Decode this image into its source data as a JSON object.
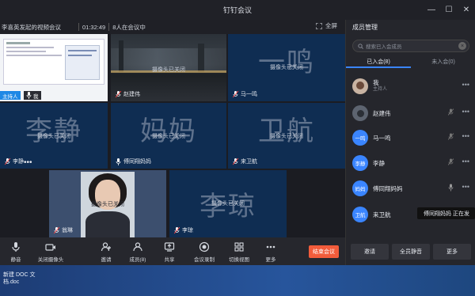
{
  "window": {
    "title": "钉钉会议"
  },
  "infobar": {
    "meeting_title": "李喜英发起的视频会议",
    "duration": "01:32:49",
    "attendance": "8人在会议中",
    "fullscreen_label": "全屏"
  },
  "tiles": [
    {
      "name": "我",
      "badge": "主持人",
      "type": "screen"
    },
    {
      "name": "赵建伟",
      "cam": "摄像头已关闭",
      "type": "scene"
    },
    {
      "name": "马一鸣",
      "big": "一鸣",
      "cam": "摄像头已关闭",
      "type": "avatar"
    },
    {
      "name": "李静",
      "big": "李静",
      "cam": "摄像头已关闭",
      "type": "avatar"
    },
    {
      "name": "傅同翔妈妈",
      "big": "妈妈",
      "cam": "摄像头已关闭",
      "type": "avatar"
    },
    {
      "name": "来卫航",
      "big": "卫航",
      "cam": "摄像头已关闭",
      "type": "avatar"
    },
    {
      "name": "翁琳",
      "cam": "摄像头已关闭",
      "type": "photo"
    },
    {
      "name": "李琼",
      "big": "李琼",
      "cam": "摄像头已关闭",
      "type": "avatar"
    }
  ],
  "toolbar": {
    "mute": "静音",
    "camera": "关闭摄像头",
    "invite": "邀请",
    "members": "成员(8)",
    "share": "共享",
    "record": "会议录制",
    "switch_view": "切换视图",
    "more": "更多",
    "end": "结束会议"
  },
  "panel": {
    "title": "成员管理",
    "search_placeholder": "搜索已入会成员",
    "tab_joined": "已入会(8)",
    "tab_not_joined": "未入会(0)",
    "members": [
      {
        "name": "我",
        "role": "主持人",
        "avatar": "photo"
      },
      {
        "name": "赵建伟",
        "avatar": "photo2"
      },
      {
        "name": "马一鸣",
        "avatar_text": "一鸣"
      },
      {
        "name": "李静",
        "avatar_text": "李静"
      },
      {
        "name": "傅同翔妈妈",
        "avatar_text": "妈妈"
      },
      {
        "name": "来卫航",
        "avatar_text": "卫航"
      }
    ],
    "tooltip": "傅同翔妈妈 正在发",
    "btn_invite": "邀请",
    "btn_mute_all": "全员静音",
    "btn_more": "更多"
  },
  "desktop": {
    "file_label": "新建 DOC 文档.doc"
  },
  "colors": {
    "accent": "#3a85ff",
    "end_button": "#f25c3b",
    "tile_bg": "#0f2d52"
  }
}
